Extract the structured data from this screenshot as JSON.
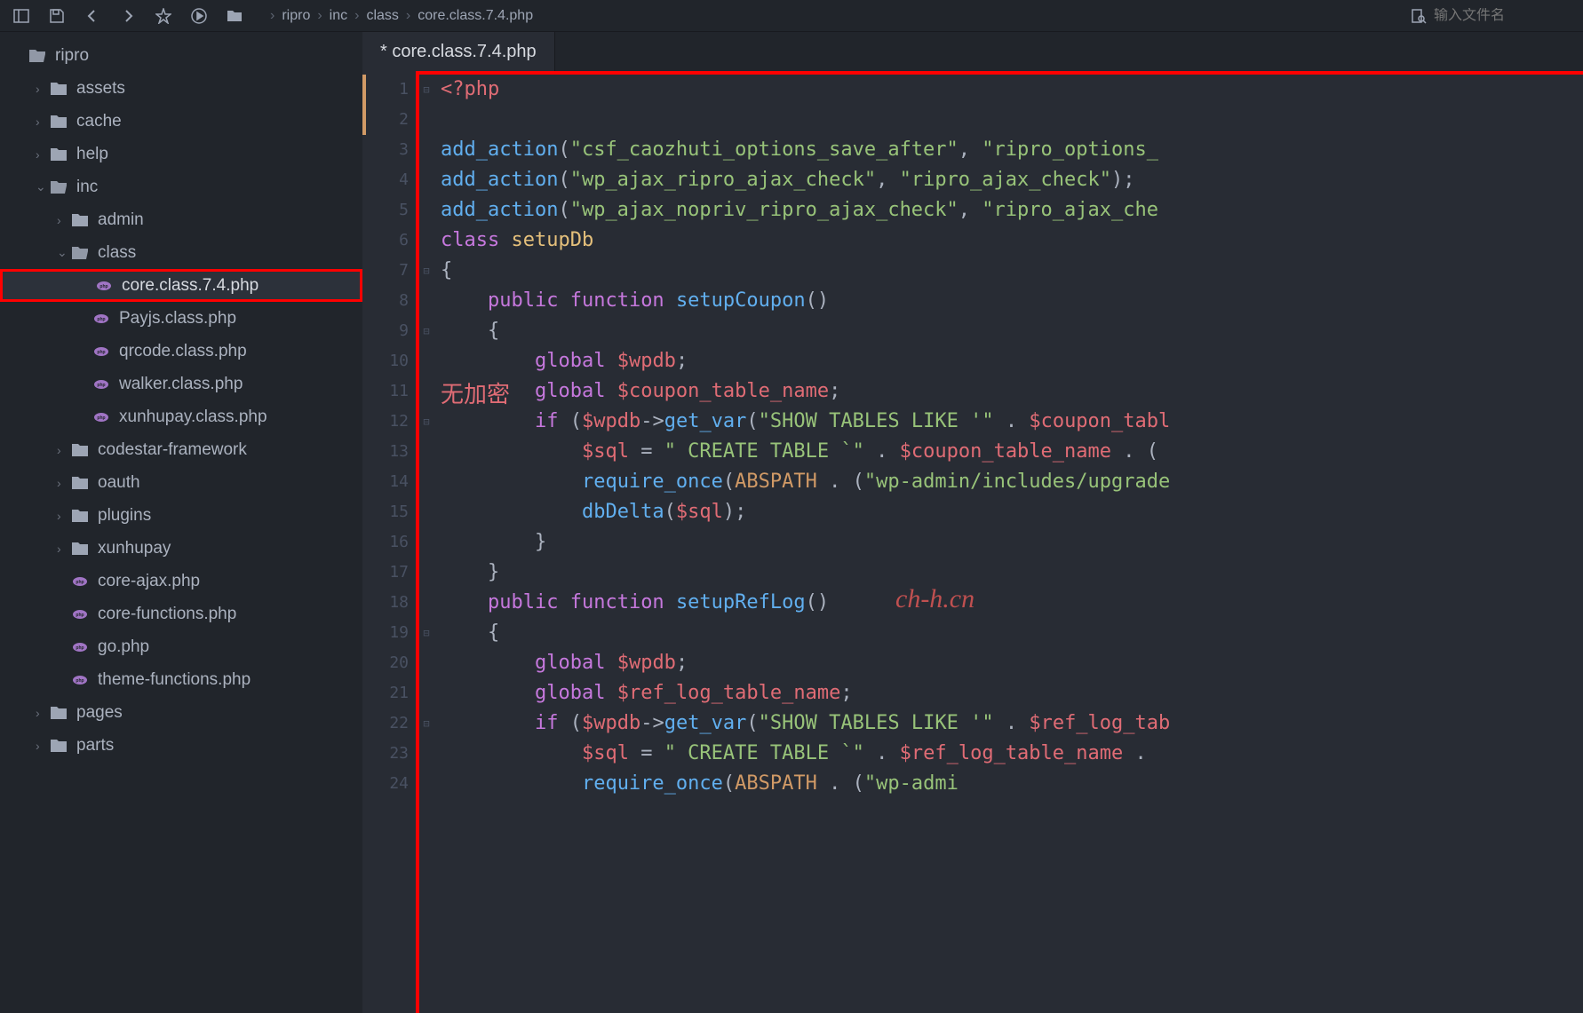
{
  "toolbar": {
    "search_placeholder": "输入文件名"
  },
  "breadcrumb": [
    "ripro",
    "inc",
    "class",
    "core.class.7.4.php"
  ],
  "tab": {
    "title": "* core.class.7.4.php"
  },
  "sidebar": {
    "items": [
      {
        "depth": 0,
        "type": "folder-open",
        "chevron": "",
        "label": "ripro"
      },
      {
        "depth": 1,
        "type": "folder",
        "chevron": "›",
        "label": "assets"
      },
      {
        "depth": 1,
        "type": "folder",
        "chevron": "›",
        "label": "cache"
      },
      {
        "depth": 1,
        "type": "folder",
        "chevron": "›",
        "label": "help"
      },
      {
        "depth": 1,
        "type": "folder-open",
        "chevron": "⌄",
        "label": "inc"
      },
      {
        "depth": 2,
        "type": "folder",
        "chevron": "›",
        "label": "admin"
      },
      {
        "depth": 2,
        "type": "folder-open",
        "chevron": "⌄",
        "label": "class"
      },
      {
        "depth": 3,
        "type": "php",
        "chevron": "",
        "label": "core.class.7.4.php",
        "highlighted": true,
        "selected": true
      },
      {
        "depth": 3,
        "type": "php",
        "chevron": "",
        "label": "Payjs.class.php"
      },
      {
        "depth": 3,
        "type": "php",
        "chevron": "",
        "label": "qrcode.class.php"
      },
      {
        "depth": 3,
        "type": "php",
        "chevron": "",
        "label": "walker.class.php"
      },
      {
        "depth": 3,
        "type": "php",
        "chevron": "",
        "label": "xunhupay.class.php"
      },
      {
        "depth": 2,
        "type": "folder",
        "chevron": "›",
        "label": "codestar-framework"
      },
      {
        "depth": 2,
        "type": "folder",
        "chevron": "›",
        "label": "oauth"
      },
      {
        "depth": 2,
        "type": "folder",
        "chevron": "›",
        "label": "plugins"
      },
      {
        "depth": 2,
        "type": "folder",
        "chevron": "›",
        "label": "xunhupay"
      },
      {
        "depth": 2,
        "type": "php",
        "chevron": "",
        "label": "core-ajax.php"
      },
      {
        "depth": 2,
        "type": "php",
        "chevron": "",
        "label": "core-functions.php"
      },
      {
        "depth": 2,
        "type": "php",
        "chevron": "",
        "label": "go.php"
      },
      {
        "depth": 2,
        "type": "php",
        "chevron": "",
        "label": "theme-functions.php"
      },
      {
        "depth": 1,
        "type": "folder",
        "chevron": "›",
        "label": "pages"
      },
      {
        "depth": 1,
        "type": "folder",
        "chevron": "›",
        "label": "parts"
      }
    ]
  },
  "code": {
    "line_start": 1,
    "line_end": 24,
    "lines_html": [
      "<span class='tok-tag'>&lt;?php</span>",
      "",
      "<span class='tok-func'>add_action</span><span class='tok-punc'>(</span><span class='tok-str'>\"csf_caozhuti_options_save_after\"</span><span class='tok-punc'>, </span><span class='tok-str'>\"ripro_options_</span>",
      "<span class='tok-func'>add_action</span><span class='tok-punc'>(</span><span class='tok-str'>\"wp_ajax_ripro_ajax_check\"</span><span class='tok-punc'>, </span><span class='tok-str'>\"ripro_ajax_check\"</span><span class='tok-punc'>);</span>",
      "<span class='tok-func'>add_action</span><span class='tok-punc'>(</span><span class='tok-str'>\"wp_ajax_nopriv_ripro_ajax_check\"</span><span class='tok-punc'>, </span><span class='tok-str'>\"ripro_ajax_che</span>",
      "<span class='tok-kw'>class</span> <span class='tok-cls'>setupDb</span>",
      "<span class='tok-punc'>{</span>",
      "    <span class='tok-kw'>public</span> <span class='tok-kw'>function</span> <span class='tok-func'>setupCoupon</span><span class='tok-punc'>()</span>",
      "    <span class='tok-punc'>{</span>",
      "        <span class='tok-kw'>global</span> <span class='tok-var'>$wpdb</span><span class='tok-punc'>;</span>",
      "        <span class='tok-kw'>global</span> <span class='tok-var'>$coupon_table_name</span><span class='tok-punc'>;</span>",
      "        <span class='tok-kw'>if</span> <span class='tok-punc'>(</span><span class='tok-var'>$wpdb</span><span class='tok-punc'>-&gt;</span><span class='tok-func'>get_var</span><span class='tok-punc'>(</span><span class='tok-str'>\"SHOW TABLES LIKE '\"</span> <span class='tok-punc'>.</span> <span class='tok-var'>$coupon_tabl</span>",
      "            <span class='tok-var'>$sql</span> <span class='tok-punc'>=</span> <span class='tok-str'>\" CREATE TABLE `\"</span> <span class='tok-punc'>.</span> <span class='tok-var'>$coupon_table_name</span> <span class='tok-punc'>. (</span>",
      "            <span class='tok-func'>require_once</span><span class='tok-punc'>(</span><span class='tok-const'>ABSPATH</span> <span class='tok-punc'>. (</span><span class='tok-str'>\"wp-admin/includes/upgrade</span>",
      "            <span class='tok-func'>dbDelta</span><span class='tok-punc'>(</span><span class='tok-var'>$sql</span><span class='tok-punc'>);</span>",
      "        <span class='tok-punc'>}</span>",
      "    <span class='tok-punc'>}</span>",
      "    <span class='tok-kw'>public</span> <span class='tok-kw'>function</span> <span class='tok-func'>setupRefLog</span><span class='tok-punc'>()</span>",
      "    <span class='tok-punc'>{</span>",
      "        <span class='tok-kw'>global</span> <span class='tok-var'>$wpdb</span><span class='tok-punc'>;</span>",
      "        <span class='tok-kw'>global</span> <span class='tok-var'>$ref_log_table_name</span><span class='tok-punc'>;</span>",
      "        <span class='tok-kw'>if</span> <span class='tok-punc'>(</span><span class='tok-var'>$wpdb</span><span class='tok-punc'>-&gt;</span><span class='tok-func'>get_var</span><span class='tok-punc'>(</span><span class='tok-str'>\"SHOW TABLES LIKE '\"</span> <span class='tok-punc'>.</span> <span class='tok-var'>$ref_log_tab</span>",
      "            <span class='tok-var'>$sql</span> <span class='tok-punc'>=</span> <span class='tok-str'>\" CREATE TABLE `\"</span> <span class='tok-punc'>.</span> <span class='tok-var'>$ref_log_table_name</span> <span class='tok-punc'>.</span>",
      "            <span class='tok-func'>require_once</span><span class='tok-punc'>(</span><span class='tok-const'>ABSPATH</span> <span class='tok-punc'>. (</span><span class='tok-str'>\"wp-admi</span>"
    ],
    "fold_markers": {
      "1": "⊟",
      "7": "⊟",
      "9": "⊟",
      "12": "⊟",
      "19": "⊟",
      "22": "⊟"
    }
  },
  "watermarks": {
    "w1": "无加密",
    "w2": "ch-h.cn"
  }
}
